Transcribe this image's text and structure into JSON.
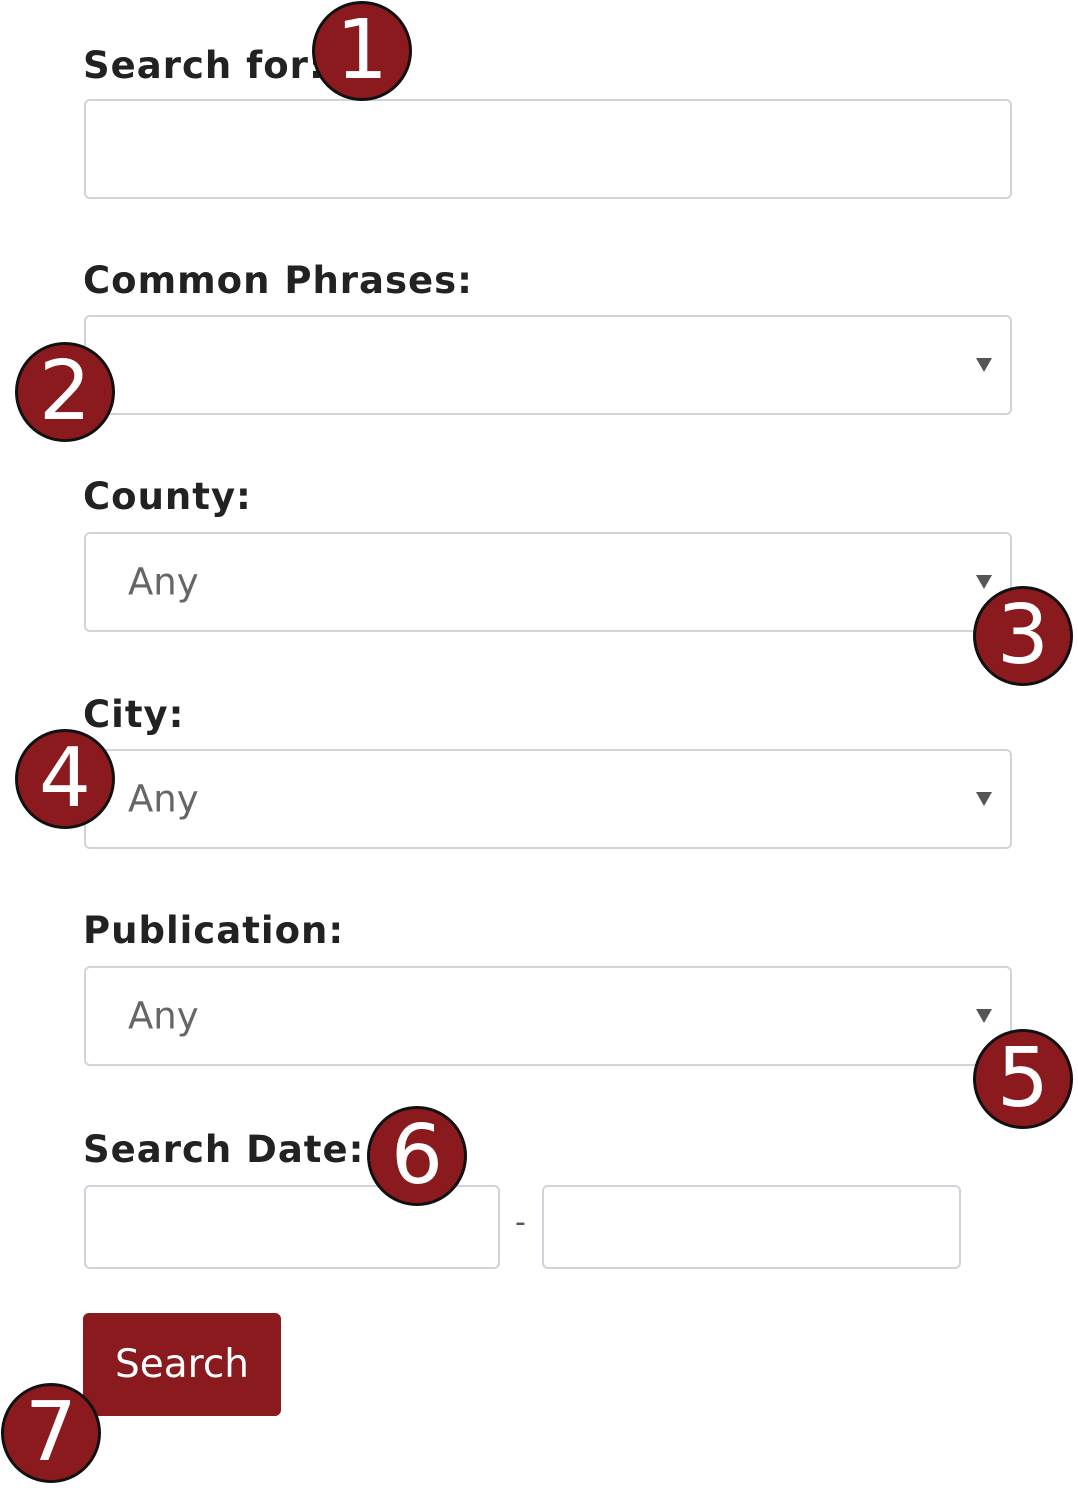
{
  "form": {
    "search_for": {
      "label": "Search for:",
      "value": ""
    },
    "common_phrases": {
      "label": "Common Phrases:",
      "selected": ""
    },
    "county": {
      "label": "County:",
      "selected": "Any"
    },
    "city": {
      "label": "City:",
      "selected": "Any"
    },
    "publication": {
      "label": "Publication:",
      "selected": "Any"
    },
    "search_date": {
      "label": "Search Date:",
      "from": "",
      "separator": "-",
      "to": ""
    },
    "submit_label": "Search"
  },
  "annotations": [
    "1",
    "2",
    "3",
    "4",
    "5",
    "6",
    "7"
  ],
  "colors": {
    "accent": "#8b1a1e",
    "border": "#ced4da",
    "label_text": "#222222",
    "placeholder_text": "#666666"
  },
  "icons": {
    "select_caret": "chevron-down-icon"
  }
}
